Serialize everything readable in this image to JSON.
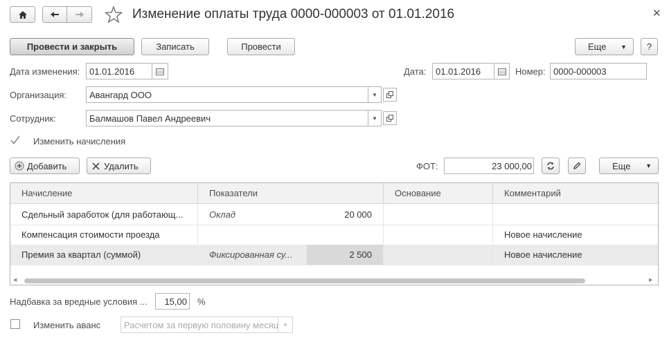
{
  "window": {
    "title": "Изменение оплаты труда 0000-000003 от 01.01.2016"
  },
  "toolbar": {
    "post_close": "Провести и закрыть",
    "save": "Записать",
    "post": "Провести",
    "more": "Еще",
    "help": "?"
  },
  "form": {
    "change_date_label": "Дата изменения:",
    "change_date_value": "01.01.2016",
    "date_label": "Дата:",
    "date_value": "01.01.2016",
    "number_label": "Номер:",
    "number_value": "0000-000003",
    "org_label": "Организация:",
    "org_value": "Авангард ООО",
    "employee_label": "Сотрудник:",
    "employee_value": "Балмашов Павел Андреевич",
    "change_accruals_label": "Изменить начисления",
    "change_accruals_checked": true
  },
  "table_toolbar": {
    "add": "Добавить",
    "delete": "Удалить",
    "fot_label": "ФОТ:",
    "fot_value": "23 000,00",
    "more": "Еще"
  },
  "table": {
    "columns": [
      "Начисление",
      "Показатели",
      "Основание",
      "Комментарий"
    ],
    "rows": [
      {
        "accrual": "Сдельный заработок (для работающ...",
        "indicator": "Оклад",
        "value": "20 000",
        "basis": "",
        "comment": ""
      },
      {
        "accrual": "Компенсация стоимости проезда",
        "indicator": "",
        "value": "",
        "basis": "",
        "comment": "Новое начисление"
      },
      {
        "accrual": "Премия за квартал (суммой)",
        "indicator": "Фиксированная су...",
        "value": "2 500",
        "basis": "",
        "comment": "Новое начисление"
      }
    ]
  },
  "bottom": {
    "hazard_label": "Надбавка за вредные условия ...",
    "hazard_value": "15,00",
    "hazard_unit": "%",
    "advance_label": "Изменить аванс",
    "advance_checked": false,
    "advance_select": "Расчетом за первую половину месяца"
  },
  "colors": {
    "selected_row": "#ebebeb",
    "selected_cell": "#d9d9d9",
    "accent_dark_button": "#d0d0d0"
  }
}
